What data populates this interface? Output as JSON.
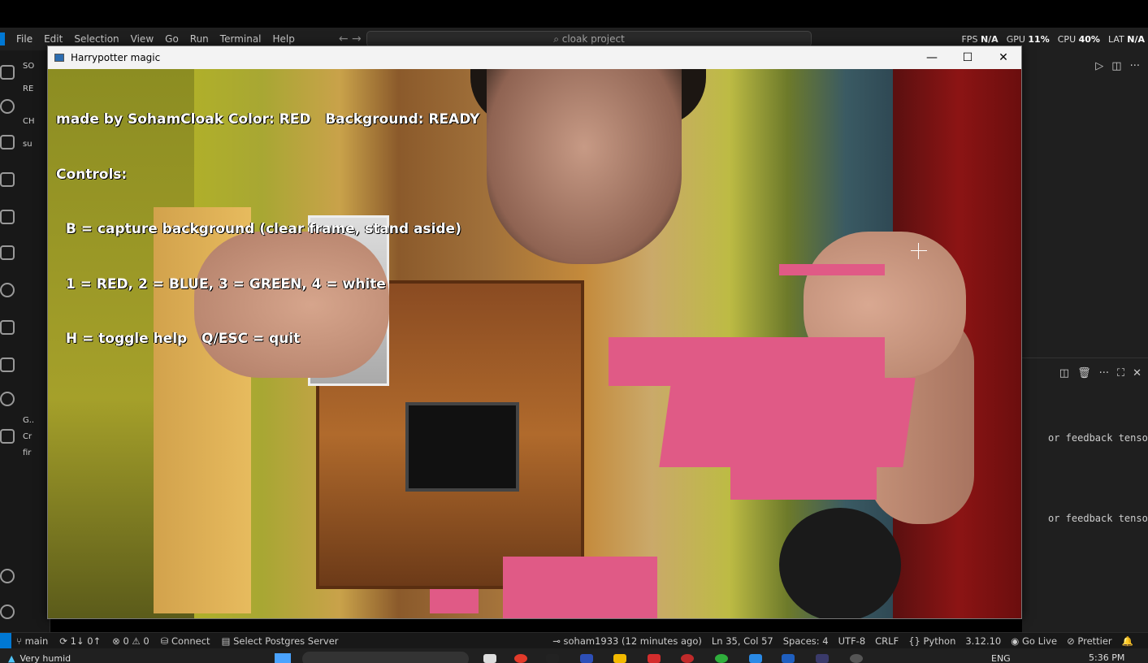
{
  "vscode": {
    "menu": [
      "File",
      "Edit",
      "Selection",
      "View",
      "Go",
      "Run",
      "Terminal",
      "Help"
    ],
    "command_center": "cloak project",
    "perf": {
      "fps_label": "FPS",
      "fps": "N/A",
      "gpu_label": "GPU",
      "gpu": "11%",
      "cpu_label": "CPU",
      "cpu": "40%",
      "lat_label": "LAT",
      "lat": "N/A"
    },
    "sidebar": {
      "explorer": "SO",
      "section_re": "RE",
      "section_ch": "CH",
      "input_su": "su",
      "section_g": "G..",
      "item_cr": "Cr",
      "item_fir": "fir"
    },
    "terminal_lines": [
      "or feedback tenso",
      "or feedback tenso"
    ],
    "statusbar": {
      "branch": "main",
      "sync": "1↓ 0↑",
      "problems": "⊗ 0 ⚠ 0",
      "connect": "Connect",
      "postgres": "Select Postgres Server",
      "blame": "soham1933 (12 minutes ago)",
      "cursor": "Ln 35, Col 57",
      "spaces": "Spaces: 4",
      "encoding": "UTF-8",
      "eol": "CRLF",
      "language": "{} Python",
      "version": "3.12.10",
      "golive": "Go Live",
      "prettier": "Prettier"
    }
  },
  "cv_window": {
    "title": "Harrypotter magic",
    "overlay_lines": [
      "made by SohamCloak Color: RED   Background: READY",
      "Controls:",
      "  B = capture background (clear frame, stand aside)",
      "  1 = RED, 2 = BLUE, 3 = GREEN, 4 = white",
      "  H = toggle help   Q/ESC = quit"
    ]
  },
  "taskbar": {
    "weather": "Very humid",
    "language": "ENG",
    "time": "5:36 PM"
  }
}
